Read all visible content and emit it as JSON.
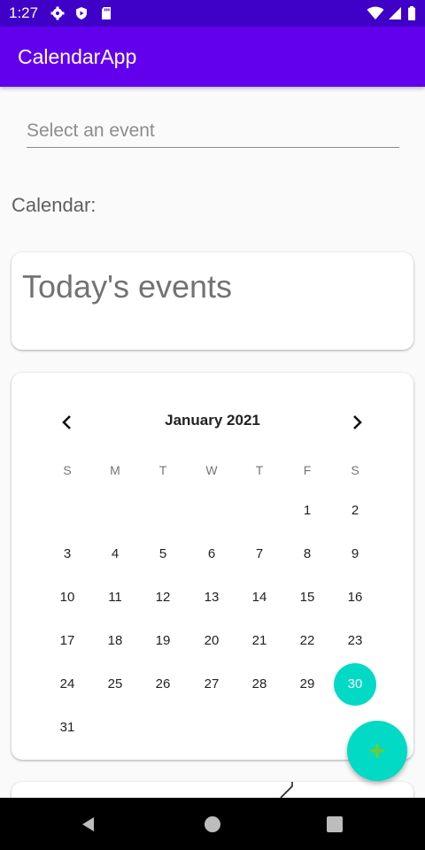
{
  "status_bar": {
    "time": "1:27",
    "icons": [
      "gear-icon",
      "shield-play-icon",
      "sd-card-icon",
      "wifi-icon",
      "signal-icon",
      "battery-icon"
    ]
  },
  "app_bar": {
    "title": "CalendarApp",
    "color": "#6200ee"
  },
  "event_select": {
    "placeholder": "Select an event"
  },
  "calendar_label": "Calendar:",
  "today_card": {
    "title": "Today's events"
  },
  "calendar": {
    "month": "January 2021",
    "weekdays": [
      "S",
      "M",
      "T",
      "W",
      "T",
      "F",
      "S"
    ],
    "weeks": [
      [
        "",
        "",
        "",
        "",
        "",
        "1",
        "2"
      ],
      [
        "3",
        "4",
        "5",
        "6",
        "7",
        "8",
        "9"
      ],
      [
        "10",
        "11",
        "12",
        "13",
        "14",
        "15",
        "16"
      ],
      [
        "17",
        "18",
        "19",
        "20",
        "21",
        "22",
        "23"
      ],
      [
        "24",
        "25",
        "26",
        "27",
        "28",
        "29",
        "30"
      ],
      [
        "31",
        "",
        "",
        "",
        "",
        "",
        ""
      ]
    ],
    "selected_day": "30",
    "accent": "#03dac5"
  },
  "fab": {
    "icon": "plus-icon",
    "color": "#03dac5"
  },
  "nav_bar": {
    "icons": [
      "back-icon",
      "home-icon",
      "recents-icon"
    ]
  }
}
